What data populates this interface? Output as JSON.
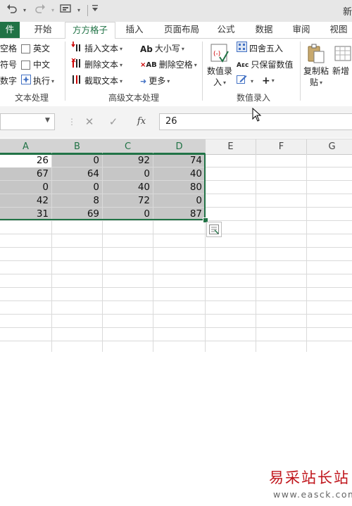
{
  "qat": {
    "undo_icon": "undo-icon",
    "redo_icon": "redo-icon",
    "customize_icon": "toolbar-customize-icon",
    "title_fragment": "新"
  },
  "tabs": [
    {
      "label": "件"
    },
    {
      "label": "开始"
    },
    {
      "label": "方方格子"
    },
    {
      "label": "插入"
    },
    {
      "label": "页面布局"
    },
    {
      "label": "公式"
    },
    {
      "label": "数据"
    },
    {
      "label": "审阅"
    },
    {
      "label": "视图"
    }
  ],
  "ribbon": {
    "group1": {
      "left_labels": [
        "空格",
        "符号",
        "数字"
      ],
      "checkboxes": [
        {
          "label": "英文"
        },
        {
          "label": "中文"
        }
      ],
      "execute_label": "执行",
      "group_label": "文本处理"
    },
    "group2": {
      "insert_text": "插入文本",
      "delete_text": "删除文本",
      "extract_text": "截取文本",
      "case_label": "大小写",
      "delete_spaces": "删除空格",
      "more_label": "更多",
      "group_label": "高级文本处理"
    },
    "group3": {
      "value_entry_line1": "数值录",
      "value_entry_line2": "入",
      "round_label": "四舍五入",
      "keep_values_label": "只保留数值",
      "group_label": "数值录入"
    },
    "group4": {
      "copy_paste_line1": "复制粘",
      "copy_paste_line2": "贴",
      "new_label": "新增"
    }
  },
  "formula_bar": {
    "name_box_value": "",
    "cancel_icon": "cancel-icon",
    "confirm_icon": "confirm-icon",
    "fx_label": "fx",
    "value": "26"
  },
  "columns": [
    "A",
    "B",
    "C",
    "D",
    "E",
    "F",
    "G"
  ],
  "cells": [
    [
      "26",
      "0",
      "92",
      "74"
    ],
    [
      "67",
      "64",
      "0",
      "40"
    ],
    [
      "0",
      "0",
      "40",
      "80"
    ],
    [
      "42",
      "8",
      "72",
      "0"
    ],
    [
      "31",
      "69",
      "0",
      "87"
    ]
  ],
  "watermark": {
    "text": "易采站长站",
    "url": "www.easck.com"
  },
  "colors": {
    "accent": "#217346",
    "selection_fill": "#c6c6c6",
    "watermark_red": "#c0161c"
  }
}
